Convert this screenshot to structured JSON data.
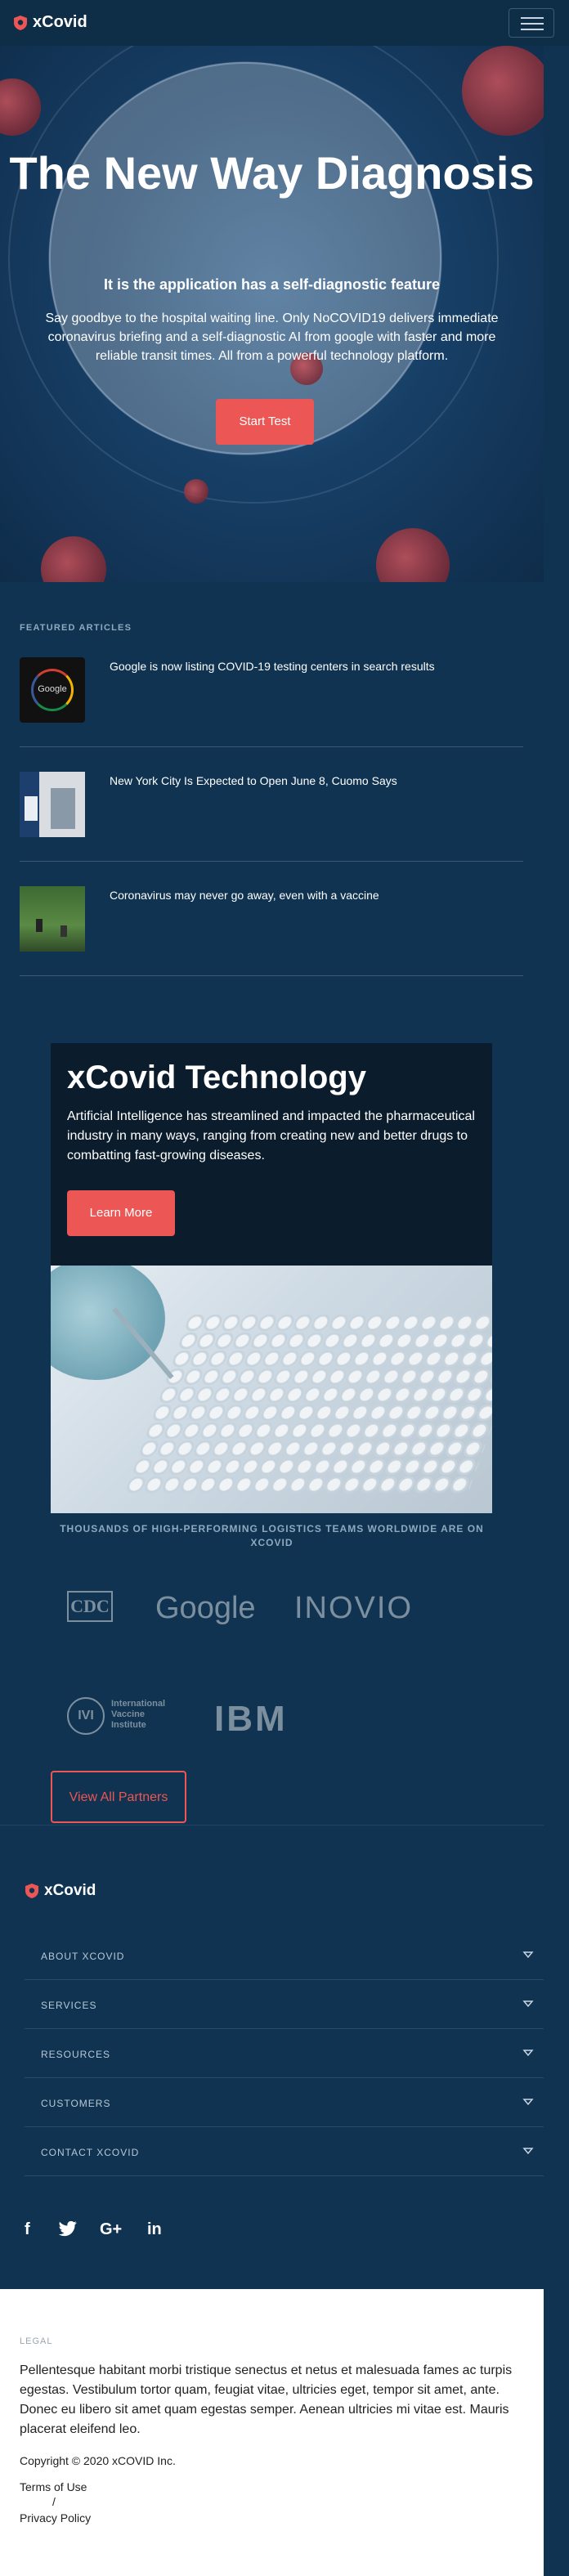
{
  "header": {
    "brand": "xCovid"
  },
  "hero": {
    "title": "The New Way Diagnosis",
    "subtitle": "It is the application has a self-diagnostic feature",
    "description": "Say goodbye to the hospital waiting line. Only NoCOVID19 delivers immediate coronavirus briefing and a self-diagnostic AI from google with faster and more reliable transit times. All from a powerful technology platform.",
    "cta": "Start Test"
  },
  "featured": {
    "label": "FEATURED ARTICLES",
    "articles": [
      {
        "title": "Google is now listing COVID-19 testing centers in search results"
      },
      {
        "title": "New York City Is Expected to Open June 8, Cuomo Says"
      },
      {
        "title": "Coronavirus may never go away, even with a vaccine"
      }
    ]
  },
  "technology": {
    "title": "xCovid Technology",
    "text": "Artificial Intelligence has streamlined and impacted the pharmaceutical industry in many ways, ranging from creating new and better drugs to combatting fast-growing diseases.",
    "cta": "Learn More"
  },
  "partners": {
    "label": "THOUSANDS OF HIGH-PERFORMING LOGISTICS TEAMS WORLDWIDE ARE ON XCOVID",
    "logos": [
      "CDC",
      "Google",
      "INOVIO",
      "International Vaccine Institute",
      "IBM"
    ],
    "cta": "View All Partners"
  },
  "footer": {
    "brand": "xCovid",
    "sections": [
      "ABOUT XCOVID",
      "SERVICES",
      "RESOURCES",
      "CUSTOMERS",
      "CONTACT XCOVID"
    ],
    "social": {
      "facebook": "f",
      "twitter": "twitter",
      "googleplus": "G+",
      "linkedin": "in"
    }
  },
  "legal": {
    "label": "LEGAL",
    "text": "Pellentesque habitant morbi tristique senectus et netus et malesuada fames ac turpis egestas. Vestibulum tortor quam, feugiat vitae, ultricies eget, tempor sit amet, ante. Donec eu libero sit amet quam egestas semper. Aenean ultricies mi vitae est. Mauris placerat eleifend leo.",
    "copyright": "Copyright © 2020 xCOVID Inc.",
    "terms": "Terms of Use",
    "separator": "/",
    "privacy": "Privacy Policy"
  },
  "colors": {
    "background": "#0f3350",
    "accent": "#ec5654",
    "panel": "#0b1c2c"
  }
}
